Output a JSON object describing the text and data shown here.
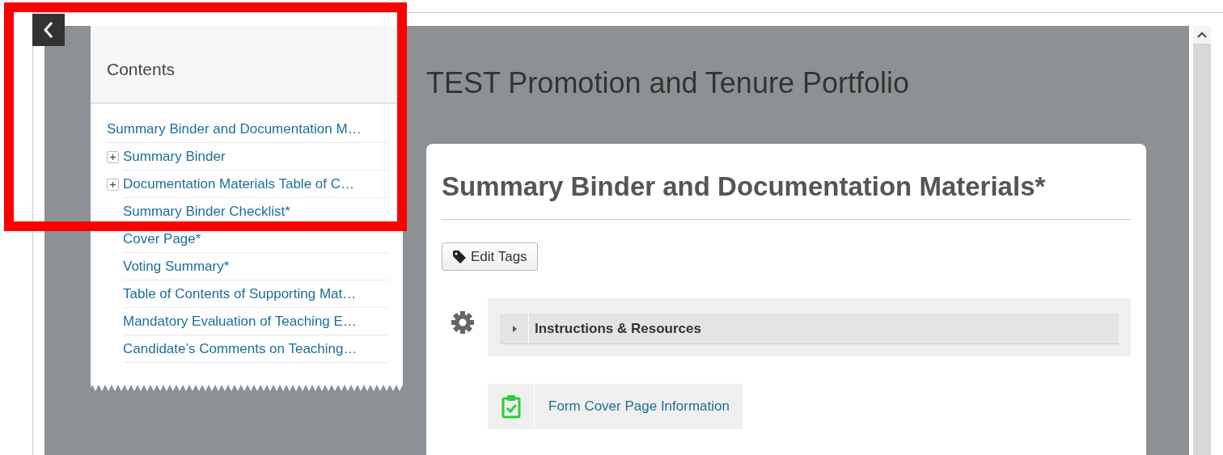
{
  "contents": {
    "title": "Contents",
    "items": [
      {
        "label": "Summary Binder and Documentation M…",
        "children": [
          {
            "label": "Summary Binder",
            "kind": "expandable",
            "expanded": false
          },
          {
            "label": "Documentation Materials Table of C…",
            "kind": "expandable",
            "expanded": false
          },
          {
            "label": "Summary Binder Checklist*",
            "kind": "page"
          },
          {
            "label": "Cover Page*",
            "kind": "page"
          },
          {
            "label": "Voting Summary*",
            "kind": "page"
          },
          {
            "label": "Table of Contents of Supporting Mat…",
            "kind": "page"
          },
          {
            "label": "Mandatory Evaluation of Teaching E…",
            "kind": "page"
          },
          {
            "label": "Candidate’s Comments on Teaching…",
            "kind": "page"
          }
        ]
      }
    ]
  },
  "page_title": "TEST Promotion and Tenure Portfolio",
  "content": {
    "heading": "Summary Binder and Documentation Materials*",
    "edit_tags_button": "Edit Tags",
    "folder": {
      "title": "Instructions & Resources",
      "expanded": false
    },
    "items": [
      {
        "label": "Form Cover Page Information",
        "kind": "form"
      }
    ]
  }
}
